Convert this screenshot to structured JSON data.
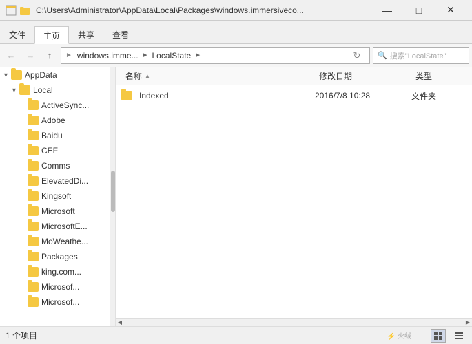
{
  "titlebar": {
    "path": "C:\\Users\\Administrator\\AppData\\Local\\Packages\\windows.immersiveco...",
    "minimize_label": "—",
    "maximize_label": "□",
    "close_label": "✕"
  },
  "ribbon": {
    "tabs": [
      {
        "label": "文件",
        "active": false
      },
      {
        "label": "主页",
        "active": true
      },
      {
        "label": "共享",
        "active": false
      },
      {
        "label": "查看",
        "active": false
      }
    ]
  },
  "navbar": {
    "back_disabled": true,
    "forward_disabled": true,
    "up_label": "↑",
    "crumbs": [
      {
        "label": "windows.imme..."
      },
      {
        "label": "LocalState"
      }
    ],
    "search_placeholder": "搜索\"LocalState\""
  },
  "sidebar": {
    "items": [
      {
        "label": "AppData",
        "indent": 1,
        "expanded": true,
        "has_arrow": true
      },
      {
        "label": "Local",
        "indent": 2,
        "expanded": true,
        "has_arrow": true
      },
      {
        "label": "ActiveSync...",
        "indent": 3,
        "has_arrow": false
      },
      {
        "label": "Adobe",
        "indent": 3,
        "has_arrow": false
      },
      {
        "label": "Baidu",
        "indent": 3,
        "has_arrow": false
      },
      {
        "label": "CEF",
        "indent": 3,
        "has_arrow": false
      },
      {
        "label": "Comms",
        "indent": 3,
        "has_arrow": false
      },
      {
        "label": "ElevatedDi...",
        "indent": 3,
        "has_arrow": false
      },
      {
        "label": "Kingsoft",
        "indent": 3,
        "has_arrow": false
      },
      {
        "label": "Microsoft",
        "indent": 3,
        "has_arrow": false
      },
      {
        "label": "MicrosoftE...",
        "indent": 3,
        "has_arrow": false
      },
      {
        "label": "MoWeathe...",
        "indent": 3,
        "has_arrow": false
      },
      {
        "label": "Packages",
        "indent": 3,
        "has_arrow": false
      },
      {
        "label": "king.com...",
        "indent": 3,
        "has_arrow": false
      },
      {
        "label": "Microsof...",
        "indent": 3,
        "has_arrow": false
      },
      {
        "label": "Microsof...",
        "indent": 3,
        "has_arrow": false
      }
    ]
  },
  "content": {
    "columns": [
      {
        "label": "名称",
        "sort_arrow": "▲"
      },
      {
        "label": "修改日期"
      },
      {
        "label": "类型"
      }
    ],
    "files": [
      {
        "name": "Indexed",
        "date": "2016/7/8  10:28",
        "type": "文件夹"
      }
    ]
  },
  "statusbar": {
    "count_text": "1 个项目",
    "view_icons": [
      "grid",
      "list"
    ],
    "active_view": "grid"
  }
}
